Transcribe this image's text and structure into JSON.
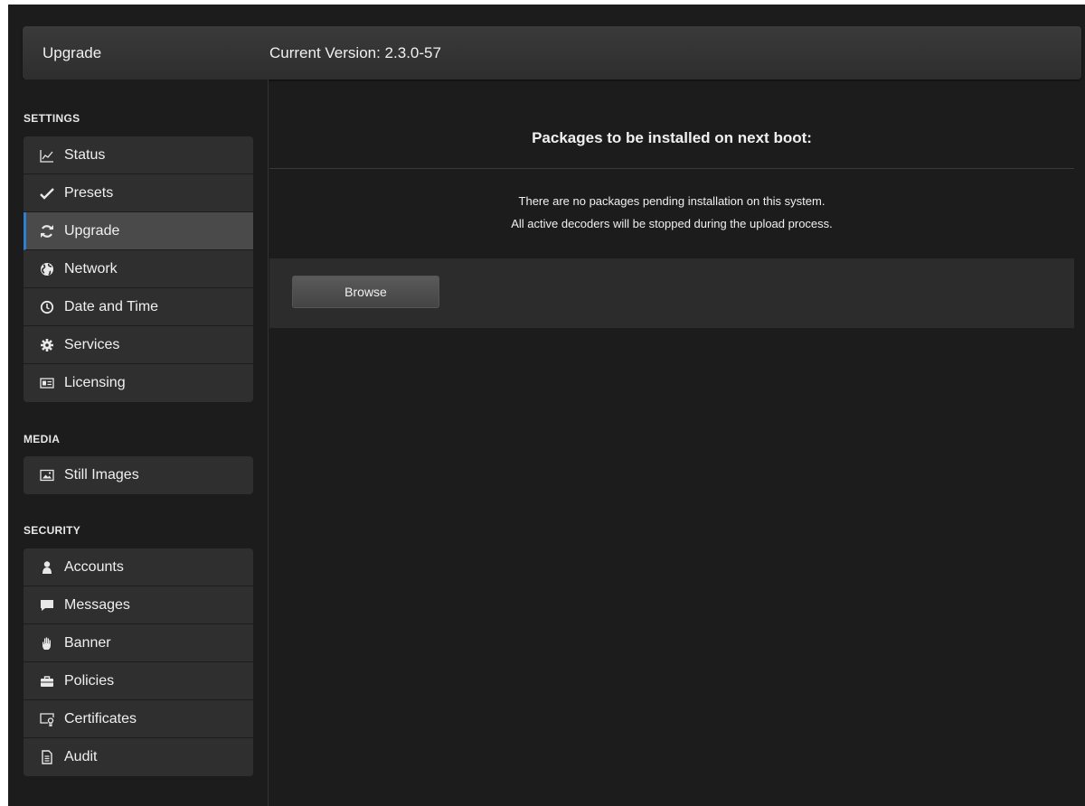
{
  "header": {
    "page_title": "Upgrade",
    "version_text": "Current Version: 2.3.0-57"
  },
  "sidebar": {
    "settings": {
      "heading": "SETTINGS",
      "items": [
        {
          "label": "Status",
          "icon": "chart-line-icon"
        },
        {
          "label": "Presets",
          "icon": "checkmark-icon"
        },
        {
          "label": "Upgrade",
          "icon": "refresh-icon",
          "active": true
        },
        {
          "label": "Network",
          "icon": "globe-icon"
        },
        {
          "label": "Date and Time",
          "icon": "clock-icon"
        },
        {
          "label": "Services",
          "icon": "gear-icon"
        },
        {
          "label": "Licensing",
          "icon": "license-card-icon"
        }
      ]
    },
    "media": {
      "heading": "MEDIA",
      "items": [
        {
          "label": "Still Images",
          "icon": "image-icon"
        }
      ]
    },
    "security": {
      "heading": "SECURITY",
      "items": [
        {
          "label": "Accounts",
          "icon": "user-icon"
        },
        {
          "label": "Messages",
          "icon": "speech-bubble-icon"
        },
        {
          "label": "Banner",
          "icon": "hand-icon"
        },
        {
          "label": "Policies",
          "icon": "briefcase-icon"
        },
        {
          "label": "Certificates",
          "icon": "certificate-icon"
        },
        {
          "label": "Audit",
          "icon": "document-icon"
        }
      ]
    }
  },
  "main": {
    "packages_title": "Packages to be installed on next boot:",
    "message_line1": "There are no packages pending installation on this system.",
    "message_line2": "All active decoders will be stopped during the upload process.",
    "browse_label": "Browse"
  },
  "colors": {
    "background": "#1c1c1c",
    "nav_item": "#2f2f2f",
    "active_item": "#4a4a4a",
    "active_accent": "#2d7fd0"
  }
}
